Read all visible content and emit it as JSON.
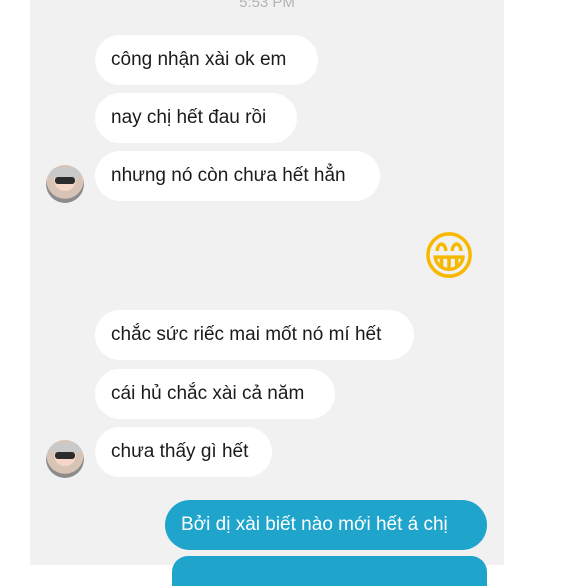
{
  "timestamp": "5:53 PM",
  "messages": [
    {
      "side": "in",
      "text": "công nhận xài ok em"
    },
    {
      "side": "in",
      "text": "nay chị hết đau rồi"
    },
    {
      "side": "in",
      "text": "nhưng nó còn chưa hết hẳn"
    },
    {
      "side": "out",
      "emoji": "😁"
    },
    {
      "side": "in",
      "text": "chắc sức riếc mai mốt nó mí hết"
    },
    {
      "side": "in",
      "text": "cái hủ chắc xài cả năm"
    },
    {
      "side": "in",
      "text": "chưa thấy gì hết"
    },
    {
      "side": "out",
      "text": "Bởi dị xài biết nào mới hết á chị"
    }
  ],
  "colors": {
    "incoming_bubble": "#ffffff",
    "outgoing_bubble": "#1fa4cc",
    "background": "#f1f1f1"
  },
  "icons": {
    "contact_avatar": "avatar-photo",
    "reaction": "grinning-face-emoji"
  }
}
